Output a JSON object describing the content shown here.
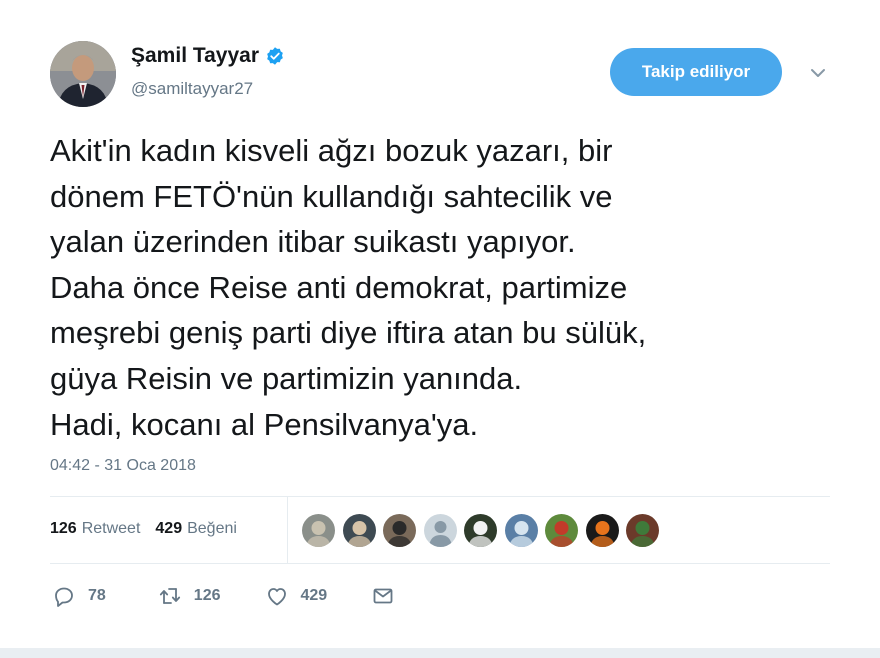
{
  "author": {
    "display_name": "Şamil Tayyar",
    "handle": "@samiltayyar27",
    "verified_icon": "verified-badge-icon"
  },
  "follow_button": {
    "label": "Takip ediliyor"
  },
  "tweet": {
    "lines": [
      "Akit'in kadın kisveli ağzı bozuk yazarı, bir",
      "dönem FETÖ'nün kullandığı sahtecilik ve",
      "yalan üzerinden itibar suikastı yapıyor.",
      "Daha önce Reise anti demokrat, partimize",
      "meşrebi geniş parti diye iftira atan bu sülük,",
      "güya Reisin ve partimizin yanında.",
      "Hadi, kocanı al Pensilvanya'ya."
    ],
    "timestamp": "04:42 - 31 Oca 2018"
  },
  "stats": {
    "retweets": {
      "count": "126",
      "label": "Retweet"
    },
    "likes": {
      "count": "429",
      "label": "Beğeni"
    }
  },
  "likers": [
    {
      "name": "liker-avatar",
      "color": "#8a8f8a",
      "accent": "#c9c2b0"
    },
    {
      "name": "liker-avatar",
      "color": "#3e4a52",
      "accent": "#d8c4a8"
    },
    {
      "name": "liker-avatar",
      "color": "#7a6a5a",
      "accent": "#2a2a2a"
    },
    {
      "name": "liker-avatar-default",
      "color": "#ccd6dd",
      "accent": "#8899a6"
    },
    {
      "name": "liker-avatar",
      "color": "#2e3b2a",
      "accent": "#f2f2f2"
    },
    {
      "name": "liker-avatar",
      "color": "#5a7fa6",
      "accent": "#d6e4ef"
    },
    {
      "name": "liker-avatar",
      "color": "#5e8a3c",
      "accent": "#c23b2a"
    },
    {
      "name": "liker-avatar",
      "color": "#1a1a1a",
      "accent": "#e8741c"
    },
    {
      "name": "liker-avatar",
      "color": "#6b3a2a",
      "accent": "#3f7a3a"
    }
  ],
  "actions": {
    "reply": {
      "count": "78",
      "icon": "reply-icon"
    },
    "retweet": {
      "count": "126",
      "icon": "retweet-icon"
    },
    "like": {
      "count": "429",
      "icon": "heart-icon"
    },
    "message": {
      "icon": "envelope-icon"
    }
  },
  "colors": {
    "accent": "#4aa8ec",
    "text": "#14171a",
    "muted": "#657786",
    "divider": "#e6ecf0"
  }
}
